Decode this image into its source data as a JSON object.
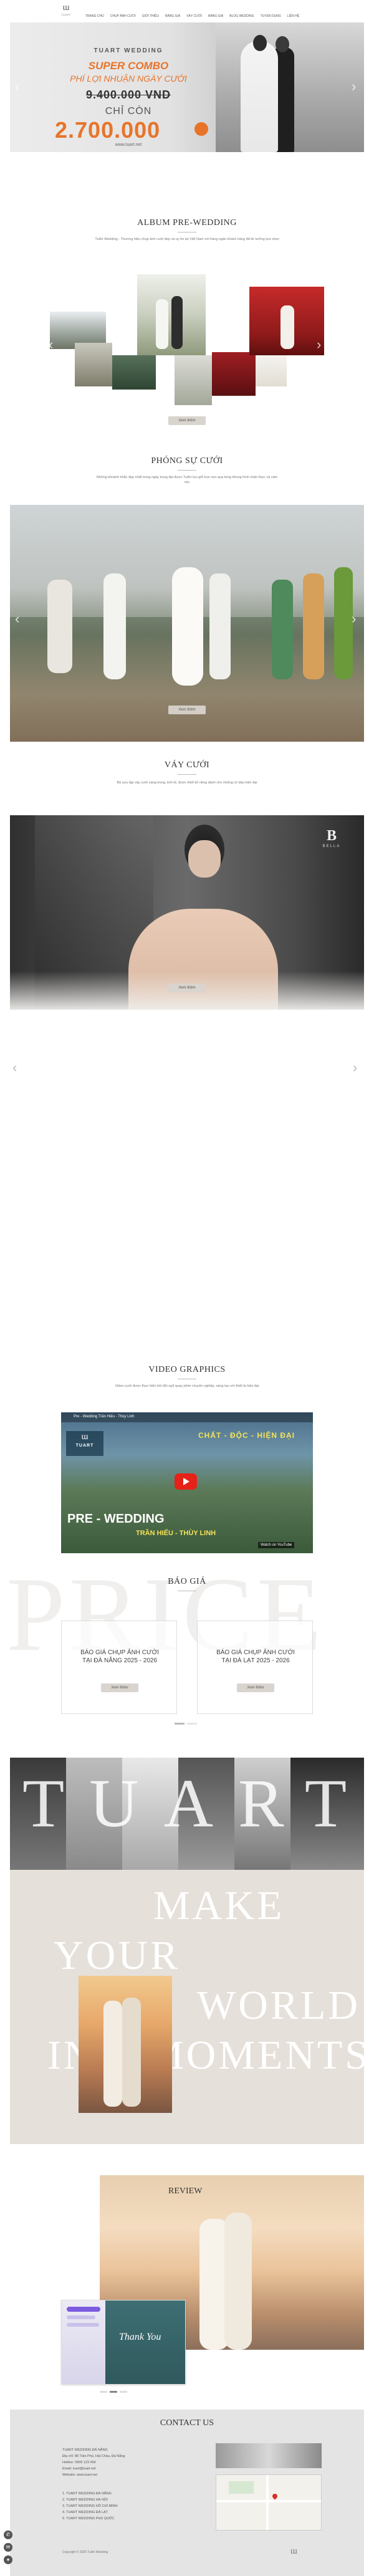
{
  "header": {
    "logo_text": "TUART",
    "nav": [
      "TRANG CHỦ",
      "CHỤP ẢNH CƯỚI",
      "GIỚI THIỆU",
      "BẢNG GIÁ",
      "VÁY CƯỚI",
      "BẢNG GIÁ",
      "BLOG WEDDING",
      "TUYỂN DỤNG",
      "LIÊN HỆ"
    ]
  },
  "hero": {
    "brand": "TUART WEDDING",
    "combo": "SUPER COMBO",
    "subtitle": "PHÍ LỢI NHUẬN NGÀY CƯỚI",
    "old_price": "9.400.000 VND",
    "only": "CHỈ CÒN",
    "price": "2.700.000",
    "website": "www.tuart.net"
  },
  "album": {
    "title": "ALBUM PRE-WEDDING",
    "desc": "TuArt Wedding - Thương hiệu chụp ảnh cưới đẹp và uy tín tại Việt Nam với hàng ngàn khách hàng đã tin tưởng lựa chọn",
    "button": "Xem thêm"
  },
  "studio": {
    "title": "PHÓNG SỰ CƯỚI",
    "desc": "Những khoảnh khắc đẹp nhất trong ngày trọng đại được TuArt lưu giữ trọn vẹn qua từng khung hình chân thực và cảm xúc",
    "button": "Xem thêm"
  },
  "dress": {
    "title": "VÁY CƯỚI",
    "desc": "Bộ sưu tập váy cưới sang trọng, tinh tế, được thiết kế riêng dành cho những cô dâu hiện đại",
    "button": "Xem thêm",
    "badge_letter": "B",
    "badge_name": "BELLA"
  },
  "video": {
    "title": "VIDEO GRAPHICS",
    "desc": "Video cưới được thực hiện bởi đội ngũ quay phim chuyên nghiệp, sáng tạo với thiết bị hiện đại",
    "channel": "TUART",
    "top_text": "Pre - Wedding Trần Hiếu - Thùy Linh",
    "tagline": "CHẤT - ĐỘC - HIỆN ĐẠI",
    "big_title": "PRE - WEDDING",
    "couple": "TRẦN HIẾU - THÙY LINH",
    "youtube": "Watch on YouTube"
  },
  "pricing": {
    "bg_word": "PRICE",
    "title": "BÁO GIÁ",
    "cards": [
      {
        "title": "BÁO GIÁ CHỤP ẢNH CƯỚI TẠI ĐÀ NẴNG 2025 - 2026",
        "button": "Xem thêm"
      },
      {
        "title": "BÁO GIÁ CHỤP ẢNH CƯỚI TẠI ĐÀ LẠT 2025 - 2026",
        "button": "Xem thêm"
      }
    ]
  },
  "banner": {
    "tuart": "TUART",
    "make": "MAKE",
    "your": "YOUR",
    "world": "WORLD",
    "in": "IN",
    "moments": "MOMENTS"
  },
  "review": {
    "title": "REVIEW",
    "card_text": "Thank You"
  },
  "contact": {
    "title": "CONTACT US",
    "lines": [
      "TUART WEDDING ĐÀ NẴNG",
      "Địa chỉ: 88 Trần Phú, Hải Châu, Đà Nẵng",
      "Hotline: 0905 123 456",
      "Email: tuart@tuart.net",
      "Website: www.tuart.net"
    ],
    "branches": [
      "1. TUART WEDDING ĐÀ NẴNG",
      "2. TUART WEDDING HÀ NỘI",
      "3. TUART WEDDING HỒ CHÍ MINH",
      "4. TUART WEDDING ĐÀ LẠT",
      "5. TUART WEDDING PHÚ QUỐC"
    ],
    "copyright": "Copyright © 2025 TuArt Wedding"
  },
  "colors": {
    "accent_orange": "#e8742a",
    "beige": "#e6e0da",
    "button": "#d9d4ce"
  }
}
